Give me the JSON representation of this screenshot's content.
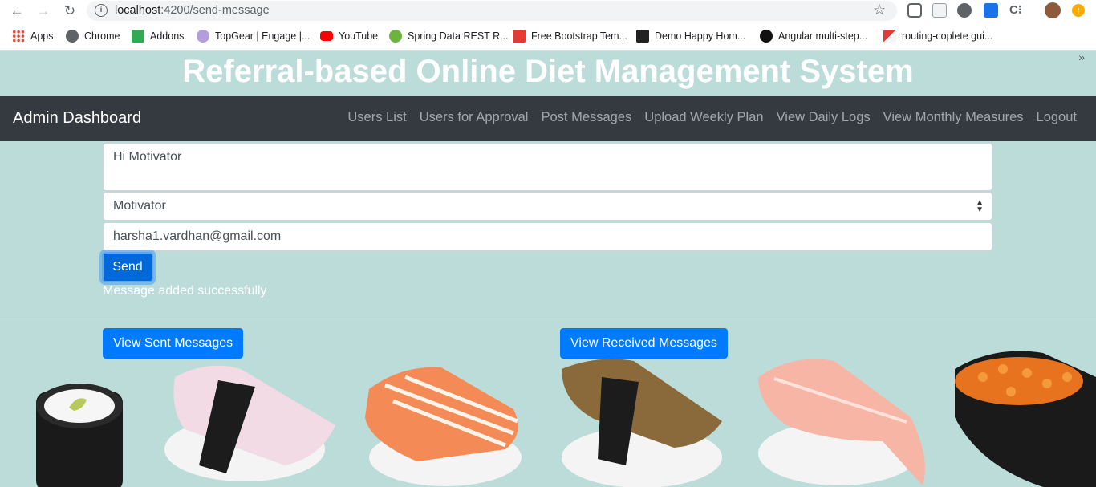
{
  "browser": {
    "url_host": "localhost",
    "url_rest": ":4200/send-message",
    "bookmarks": [
      {
        "label": "Apps",
        "icon": "apps-grid-icon",
        "color": "#ea4335"
      },
      {
        "label": "Chrome",
        "icon": "globe-icon",
        "color": "#5f6368"
      },
      {
        "label": "Addons",
        "icon": "puzzle-icon",
        "color": "#34a853"
      },
      {
        "label": "TopGear | Engage |...",
        "icon": "topgear-icon",
        "color": "#7e57c2"
      },
      {
        "label": "YouTube",
        "icon": "youtube-icon",
        "color": "#ff0000"
      },
      {
        "label": "Spring Data REST R...",
        "icon": "spring-icon",
        "color": "#6db33f"
      },
      {
        "label": "Free Bootstrap Tem...",
        "icon": "bootstrap-s-icon",
        "color": "#e53935"
      },
      {
        "label": "Demo Happy Hom...",
        "icon": "w3-icon",
        "color": "#222222"
      },
      {
        "label": "Angular multi-step...",
        "icon": "github-icon",
        "color": "#111111"
      },
      {
        "label": "routing-coplete gui...",
        "icon": "bookmark-app-icon",
        "color": "#e53935"
      }
    ]
  },
  "page": {
    "title": "Referral-based Online Diet Management System",
    "brand": "Admin Dashboard",
    "nav": [
      "Users List",
      "Users for Approval",
      "Post Messages",
      "Upload Weekly Plan",
      "View Daily Logs",
      "View Monthly Measures",
      "Logout"
    ]
  },
  "form": {
    "message": "Hi Motivator",
    "recipient_role": "Motivator",
    "email": "harsha1.vardhan@gmail.com",
    "send_label": "Send",
    "status": "Message added successfully"
  },
  "actions": {
    "sent": "View Sent Messages",
    "received": "View Received Messages"
  },
  "colors": {
    "page_bg": "#bcdcda",
    "navbar": "#343a40",
    "primary": "#007bff"
  }
}
